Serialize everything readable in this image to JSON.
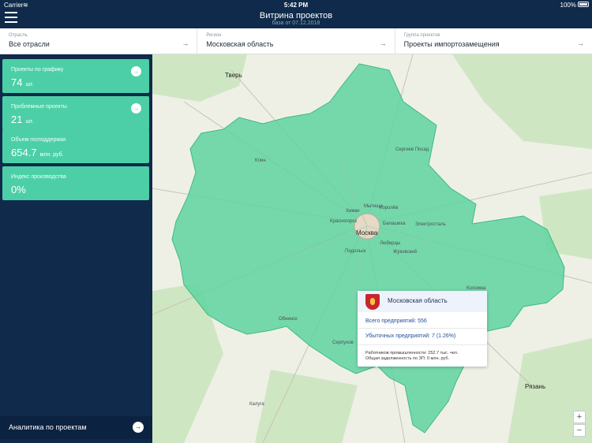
{
  "status_bar": {
    "carrier": "Carrier",
    "time": "5:42 PM",
    "battery": "100%"
  },
  "header": {
    "title": "Витрина проектов",
    "subtitle": "база от 07.12.2018"
  },
  "filters": [
    {
      "caption": "Отрасль",
      "value": "Все отрасли"
    },
    {
      "caption": "Регион",
      "value": "Московская область"
    },
    {
      "caption": "Группа проектов",
      "value": "Проекты импортозамещения"
    }
  ],
  "cards": [
    {
      "label": "Проекты по графику",
      "value": "74",
      "unit": "шт."
    },
    {
      "label": "Проблемные проекты",
      "value": "21",
      "unit": "шт."
    },
    {
      "label": "Объем господдержки",
      "value": "654.7",
      "unit": "млн. руб."
    },
    {
      "label": "Индекс производства",
      "value": "0%",
      "unit": ""
    }
  ],
  "analytics_label": "Аналитика по проектам",
  "map": {
    "cities": [
      "Тверь",
      "Москва",
      "Рязань",
      "Калуга",
      "Обнинск",
      "Серпухов",
      "Коломна",
      "Клин",
      "Электросталь",
      "Люберцы",
      "Подольск",
      "Красногорск",
      "Балашиха",
      "Королёв",
      "Мытищи",
      "Химки",
      "Сергиев Посад",
      "Жуковский"
    ],
    "zoom_in": "+",
    "zoom_out": "−",
    "region_color": "#5fd3a0"
  },
  "popup": {
    "region_name": "Московская область",
    "total_enterprises": "Всего предприятий: 556",
    "loss_enterprises": "Убыточных предприятий: 7 (1.26%)",
    "workers": "Работников промышленности: 252.7 тыс. чел.",
    "debt": "Общая задолженность по ЗП: 0 млн. руб."
  }
}
